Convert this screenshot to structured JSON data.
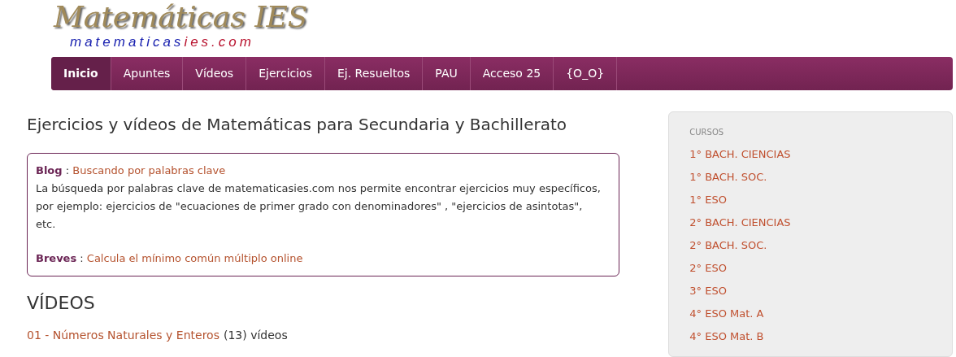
{
  "logo": {
    "title": "Matemáticas IES",
    "domain_parts": [
      {
        "text": "matematicas",
        "color": "#1a22b0"
      },
      {
        "text": "ies.com",
        "color": "#b8122e"
      }
    ]
  },
  "nav": [
    {
      "label": "Inicio",
      "selected": true
    },
    {
      "label": "Apuntes",
      "selected": false
    },
    {
      "label": "Vídeos",
      "selected": false
    },
    {
      "label": "Ejercicios",
      "selected": false
    },
    {
      "label": "Ej. Resueltos",
      "selected": false
    },
    {
      "label": "PAU",
      "selected": false
    },
    {
      "label": "Acceso 25",
      "selected": false
    },
    {
      "label": "{O_O}",
      "selected": false
    }
  ],
  "heading": "Ejercicios y vídeos de Matemáticas para Secundaria y Bachillerato",
  "news": {
    "blog_label": "Blog",
    "blog_sep": " :",
    "blog_link": "Buscando por palabras clave",
    "blog_text": "La búsqueda por palabras clave de matematicasies.com nos permite encontrar ejercicios muy específicos, por ejemplo: ejercicios de \"ecuaciones de primer grado con denominadores\" , \"ejercicios de asintotas\", etc.",
    "breves_label": "Breves",
    "breves_sep": " :",
    "breves_link": "Calcula el mínimo común múltiplo online"
  },
  "videos": {
    "title": "VÍDEOS",
    "items": [
      {
        "link": "01 - Números Naturales y Enteros",
        "count": "(13) vídeos"
      }
    ]
  },
  "sidebar": {
    "title": "CURSOS",
    "items": [
      "1° BACH. CIENCIAS",
      "1° BACH. SOC.",
      "1° ESO",
      "2° BACH. CIENCIAS",
      "2° BACH. SOC.",
      "2° ESO",
      "3° ESO",
      "4° ESO Mat. A",
      "4° ESO Mat. B"
    ]
  }
}
